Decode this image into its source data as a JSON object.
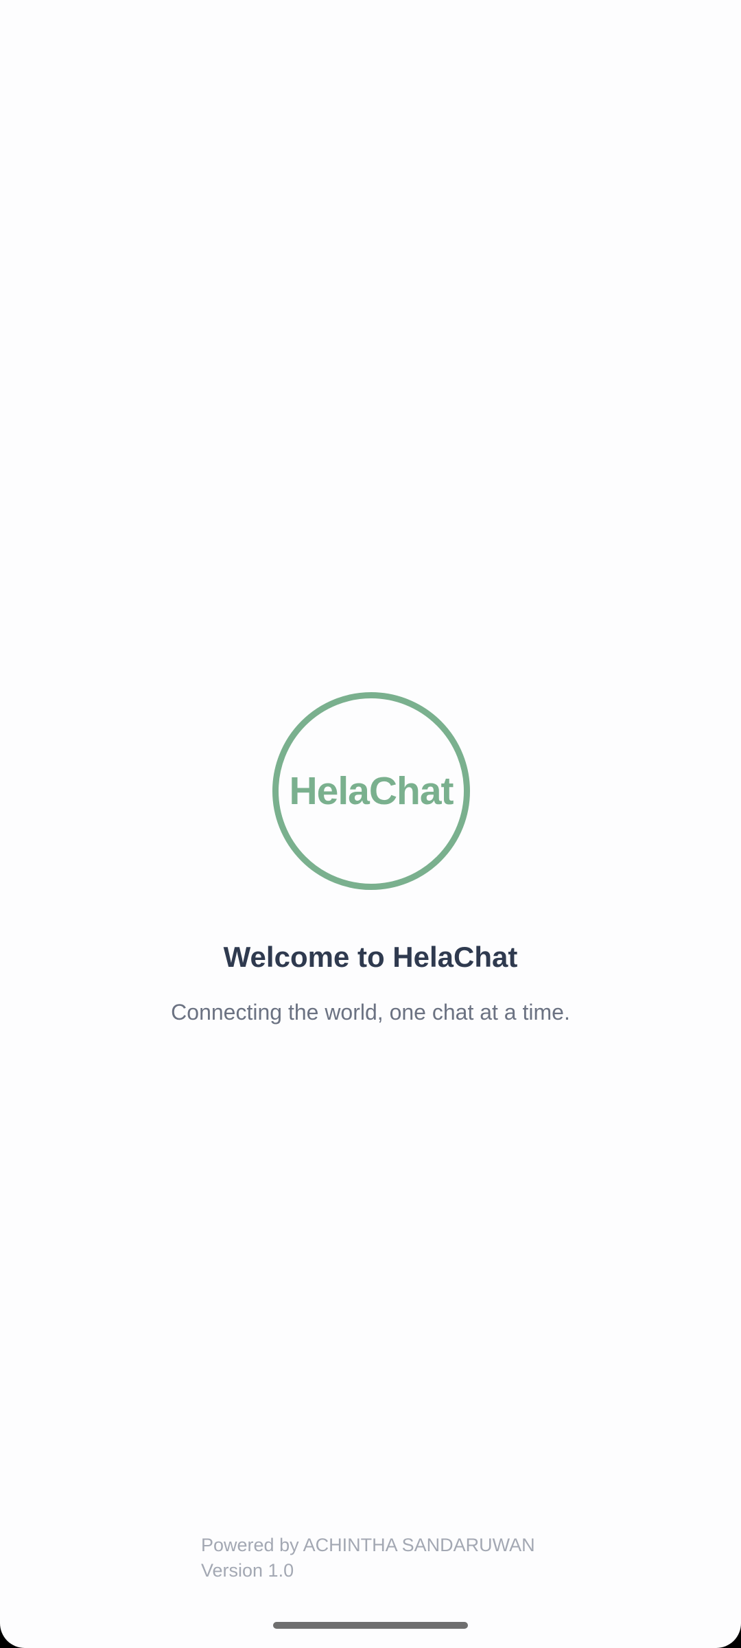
{
  "logo": {
    "text": "HelaChat",
    "color": "#7ab08e"
  },
  "welcome": {
    "title": "Welcome to HelaChat",
    "subtitle": "Connecting the world, one chat at a time."
  },
  "footer": {
    "powered_by": "Powered by ACHINTHA SANDARUWAN",
    "version": "Version 1.0"
  },
  "colors": {
    "background": "#fdfdfe",
    "title": "#2f3a4f",
    "subtitle": "#6b7282",
    "footer": "#a3a8b3"
  }
}
